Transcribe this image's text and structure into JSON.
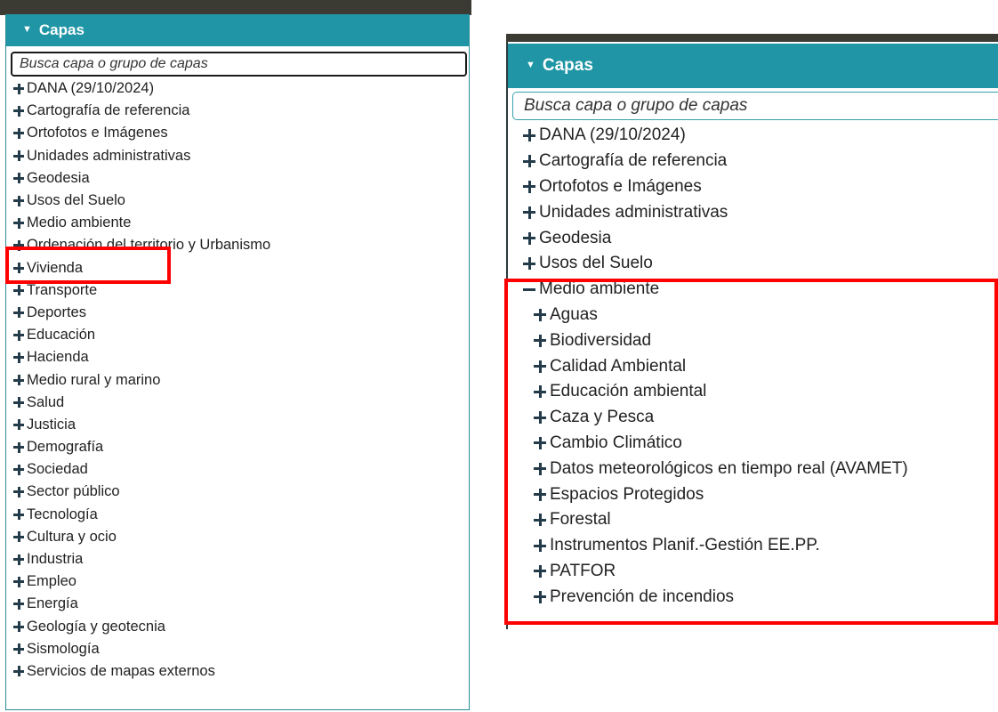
{
  "panel_left": {
    "title": "Capas",
    "search_placeholder": "Busca capa o grupo de capas",
    "items": [
      {
        "label": "DANA (29/10/2024)"
      },
      {
        "label": "Cartografía de referencia"
      },
      {
        "label": "Ortofotos e Imágenes"
      },
      {
        "label": "Unidades administrativas"
      },
      {
        "label": "Geodesia"
      },
      {
        "label": "Usos del Suelo"
      },
      {
        "label": "Medio ambiente"
      },
      {
        "label": "Ordenación del territorio y Urbanismo"
      },
      {
        "label": "Vivienda"
      },
      {
        "label": "Transporte"
      },
      {
        "label": "Deportes"
      },
      {
        "label": "Educación"
      },
      {
        "label": "Hacienda"
      },
      {
        "label": "Medio rural y marino"
      },
      {
        "label": "Salud"
      },
      {
        "label": "Justicia"
      },
      {
        "label": "Demografía"
      },
      {
        "label": "Sociedad"
      },
      {
        "label": "Sector público"
      },
      {
        "label": "Tecnología"
      },
      {
        "label": "Cultura y ocio"
      },
      {
        "label": "Industria"
      },
      {
        "label": "Empleo"
      },
      {
        "label": "Energía"
      },
      {
        "label": "Geología y geotecnia"
      },
      {
        "label": "Sismología"
      },
      {
        "label": "Servicios de mapas externos"
      }
    ]
  },
  "panel_right": {
    "title": "Capas",
    "search_placeholder": "Busca capa o grupo de capas",
    "items": [
      {
        "label": "DANA (29/10/2024)"
      },
      {
        "label": "Cartografía de referencia"
      },
      {
        "label": "Ortofotos e Imágenes"
      },
      {
        "label": "Unidades administrativas"
      },
      {
        "label": "Geodesia"
      },
      {
        "label": "Usos del Suelo"
      },
      {
        "label": "Medio ambiente"
      }
    ],
    "sub_items": [
      {
        "label": "Aguas"
      },
      {
        "label": "Biodiversidad"
      },
      {
        "label": "Calidad Ambiental"
      },
      {
        "label": "Educación ambiental"
      },
      {
        "label": "Caza y Pesca"
      },
      {
        "label": "Cambio Climático"
      },
      {
        "label": "Datos meteorológicos en tiempo real (AVAMET)"
      },
      {
        "label": "Espacios Protegidos"
      },
      {
        "label": "Forestal"
      },
      {
        "label": "Instrumentos Planif.-Gestión EE.PP."
      },
      {
        "label": "PATFOR"
      },
      {
        "label": "Prevención de incendios"
      }
    ]
  },
  "colors": {
    "header_bg": "#1f95a5",
    "highlight": "#ff0000",
    "tree_icon": "#243b4a"
  }
}
